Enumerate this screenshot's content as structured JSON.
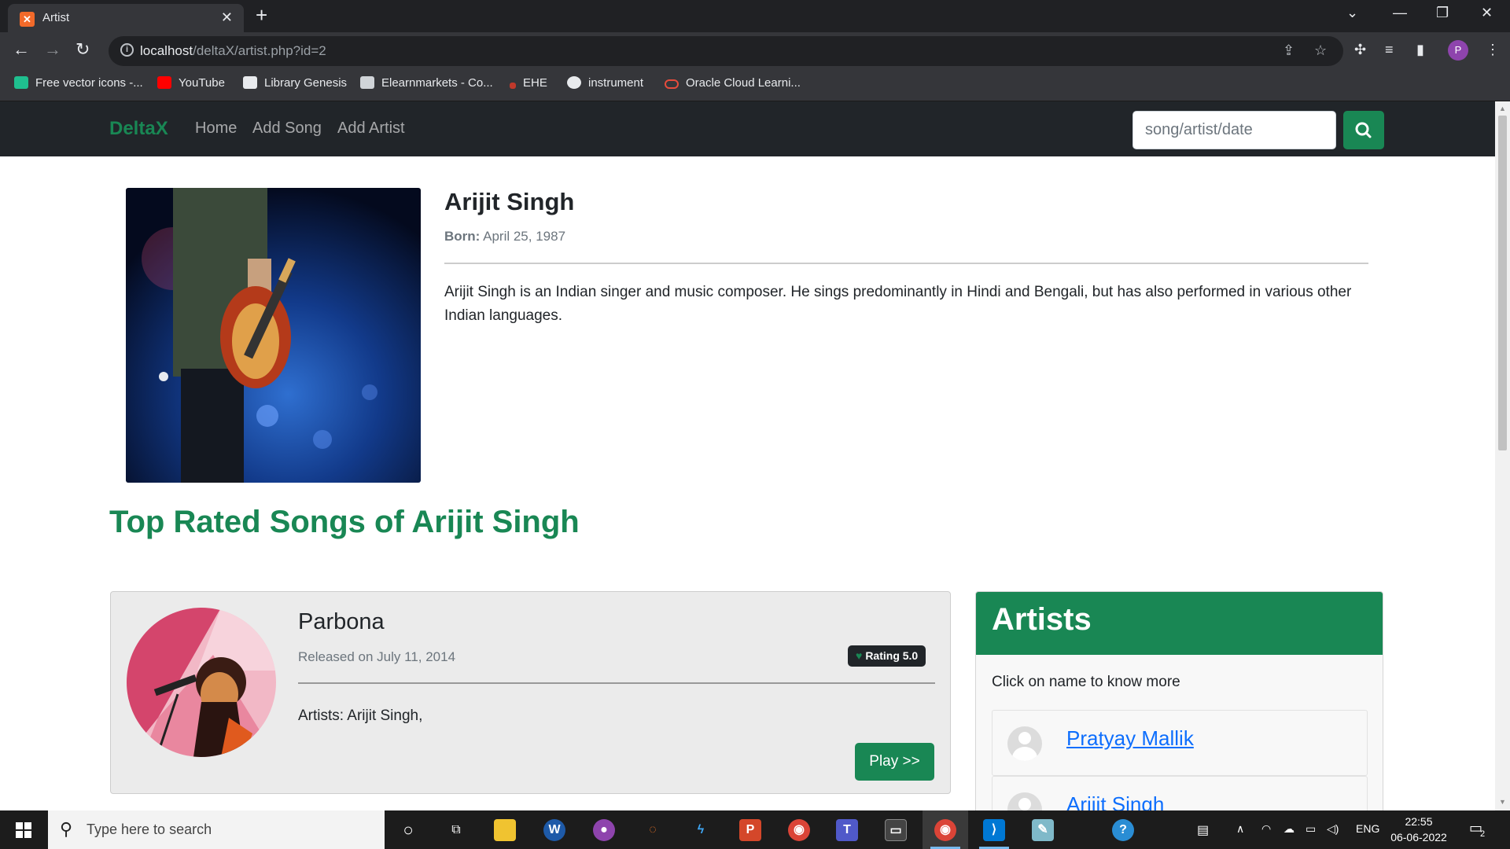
{
  "browser": {
    "tab_title": "Artist",
    "url_host": "localhost",
    "url_path": "/deltaX/artist.php?id=2",
    "profile_initial": "P",
    "bookmarks": [
      "Free vector icons -...",
      "YouTube",
      "Library Genesis",
      "Elearnmarkets - Co...",
      "EHE",
      "instrument",
      "Oracle Cloud Learni..."
    ]
  },
  "app": {
    "brand": "DeltaX",
    "nav": [
      "Home",
      "Add Song",
      "Add Artist"
    ],
    "search_placeholder": "song/artist/date"
  },
  "artist": {
    "name": "Arijit Singh",
    "born_label": "Born:",
    "born_date": "April 25, 1987",
    "bio": "Arijit Singh is an Indian singer and music composer. He sings predominantly in Hindi and Bengali, but has also performed in various other Indian languages."
  },
  "top_rated_heading": "Top Rated Songs of Arijit Singh",
  "songs": [
    {
      "title": "Parbona",
      "released": "Released on July 11, 2014",
      "rating": "Rating 5.0",
      "artists": "Artists: Arijit Singh,",
      "play_label": "Play >>"
    }
  ],
  "artists_panel": {
    "title": "Artists",
    "subtitle": "Click on name to know more",
    "items": [
      "Pratyay Mallik",
      "Arijit Singh"
    ]
  },
  "taskbar": {
    "search_placeholder": "Type here to search",
    "lang": "ENG",
    "time": "22:55",
    "date": "06-06-2022",
    "notification_count": "2"
  },
  "colors": {
    "accent_green": "#198754",
    "navbar_dark": "#212529",
    "link_blue": "#0d6efd"
  }
}
